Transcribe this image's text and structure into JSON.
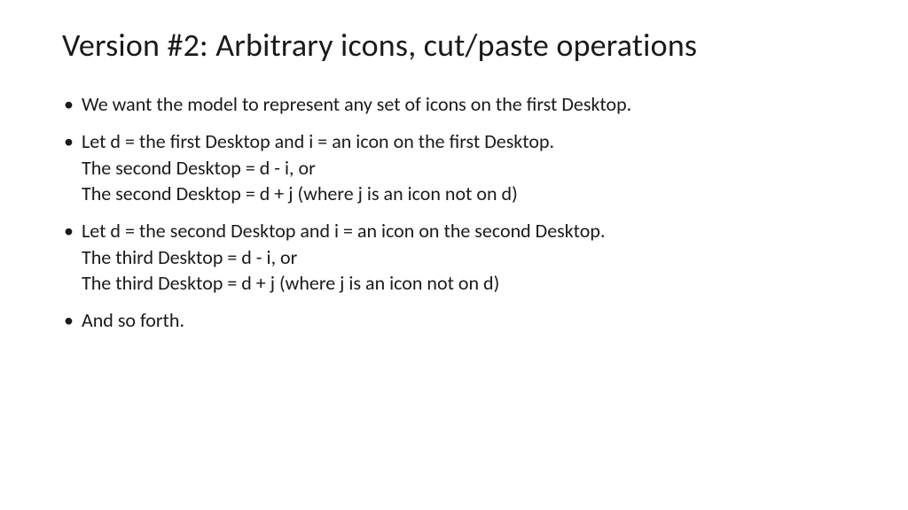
{
  "title": "Version #2: Arbitrary icons, cut/paste operations",
  "bullets": {
    "b0": {
      "l0": "We want the model to represent any set of icons on the first Desktop."
    },
    "b1": {
      "l0": "Let d = the first Desktop and i = an icon on the first Desktop.",
      "l1": "The second Desktop = d - i, or",
      "l2": "The second Desktop = d + j (where j is an icon not on d)"
    },
    "b2": {
      "l0": "Let d = the second Desktop and i = an icon on the second Desktop.",
      "l1": "The third Desktop = d - i, or",
      "l2": "The third Desktop = d + j (where j is an icon not on d)"
    },
    "b3": {
      "l0": "And so forth."
    }
  }
}
